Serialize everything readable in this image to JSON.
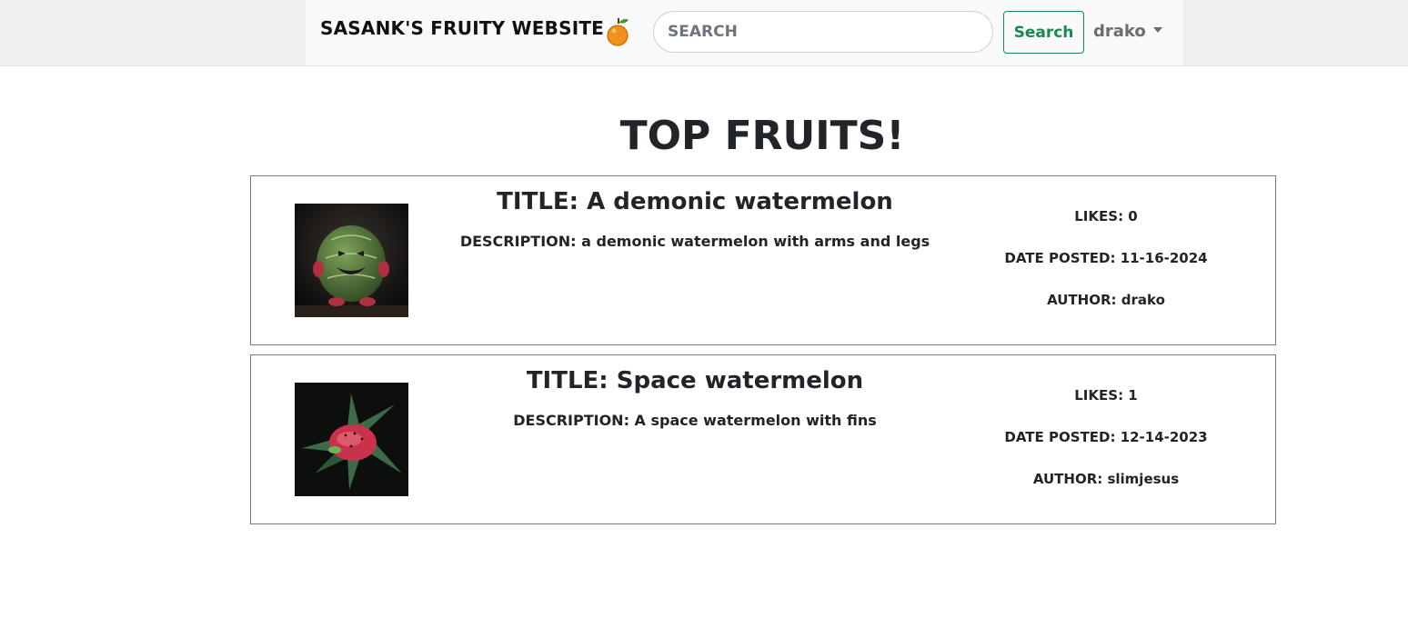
{
  "navbar": {
    "brand": "SASANK'S FRUITY WEBSITE",
    "brand_icon": "orange-icon",
    "search_placeholder": "SEARCH",
    "search_value": "",
    "search_button_label": "Search",
    "user_label": "drako",
    "user_icon": "caret-down-icon"
  },
  "main": {
    "title": "TOP FRUITS!",
    "posts": [
      {
        "title": "TITLE: A demonic watermelon",
        "description": "DESCRIPTION: a demonic watermelon with arms and legs",
        "likes": "LIKES: 0",
        "date_posted": "DATE POSTED: 11-16-2024",
        "author": "AUTHOR: drako",
        "image_icon": "demonic-watermelon-image"
      },
      {
        "title": "TITLE: Space watermelon",
        "description": "DESCRIPTION: A space watermelon with fins",
        "likes": "LIKES: 1",
        "date_posted": "DATE POSTED: 12-14-2023",
        "author": "AUTHOR: slimjesus",
        "image_icon": "space-watermelon-image"
      }
    ]
  },
  "colors": {
    "accent": "#198754",
    "navbar_bg": "#f8f9fa",
    "text": "#212529"
  }
}
